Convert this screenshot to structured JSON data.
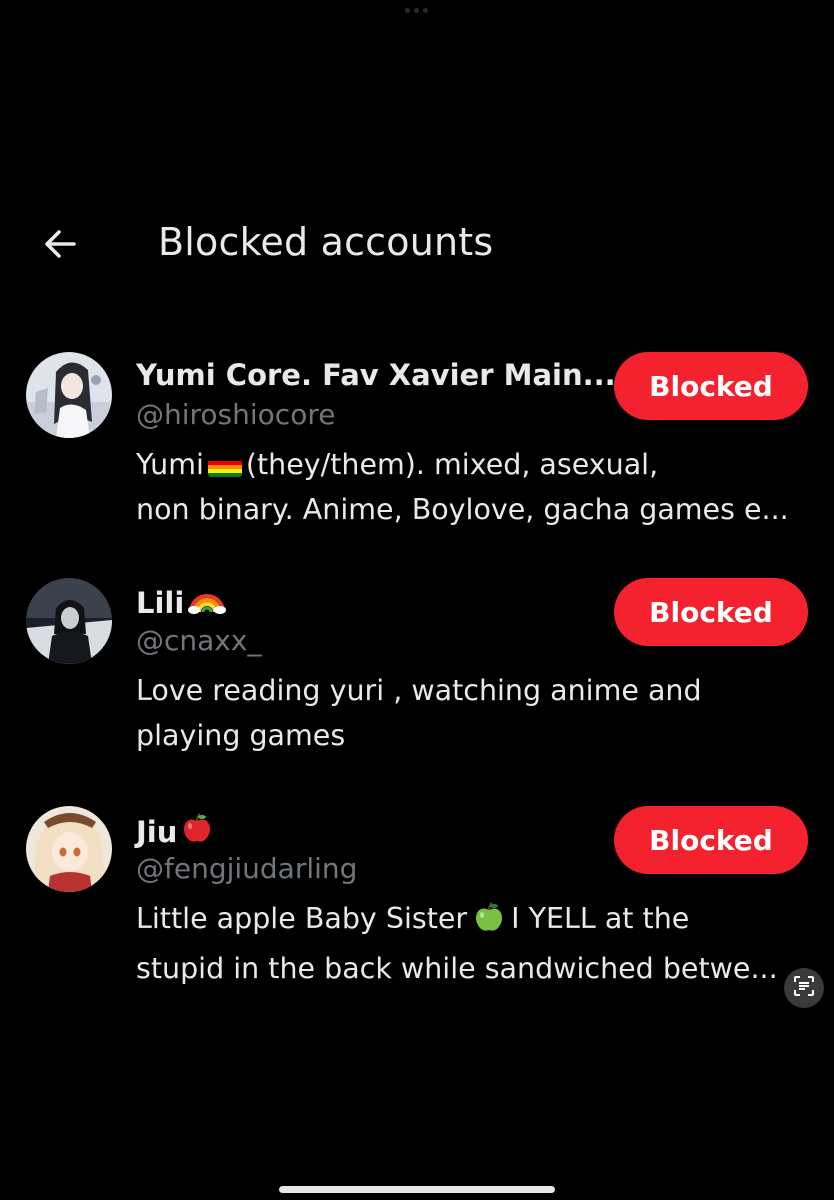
{
  "header": {
    "title": "Blocked accounts",
    "back_icon": "arrow-left-icon"
  },
  "accounts": [
    {
      "display_name": "Yumi Core. Fav Xavier Main...",
      "handle": "@hiroshiocore",
      "bio_line1_a": "Yumi",
      "bio_line1_emoji": "rainbow-flag-icon",
      "bio_line1_b": "(they/them). mixed, asexual,",
      "bio_line2": "non binary. Anime, Boylove, gacha games e...",
      "button_label": "Blocked"
    },
    {
      "display_name": "Lili",
      "name_emoji": "rainbow-icon",
      "handle": "@cnaxx_",
      "bio_line1": "Love reading yuri , watching anime and",
      "bio_line2": "playing games",
      "button_label": "Blocked"
    },
    {
      "display_name": "Jiu",
      "name_emoji": "red-apple-icon",
      "handle": "@fengjiudarling",
      "bio_line1_a": "Little apple Baby Sister",
      "bio_line1_emoji": "green-apple-icon",
      "bio_line1_b": "I YELL at the",
      "bio_line2": "stupid in the back while sandwiched betwe...",
      "button_label": "Blocked"
    }
  ],
  "colors": {
    "background": "#000000",
    "primary_text": "#e7e9ea",
    "secondary_text": "#71767b",
    "blocked_button": "#f4212e"
  }
}
